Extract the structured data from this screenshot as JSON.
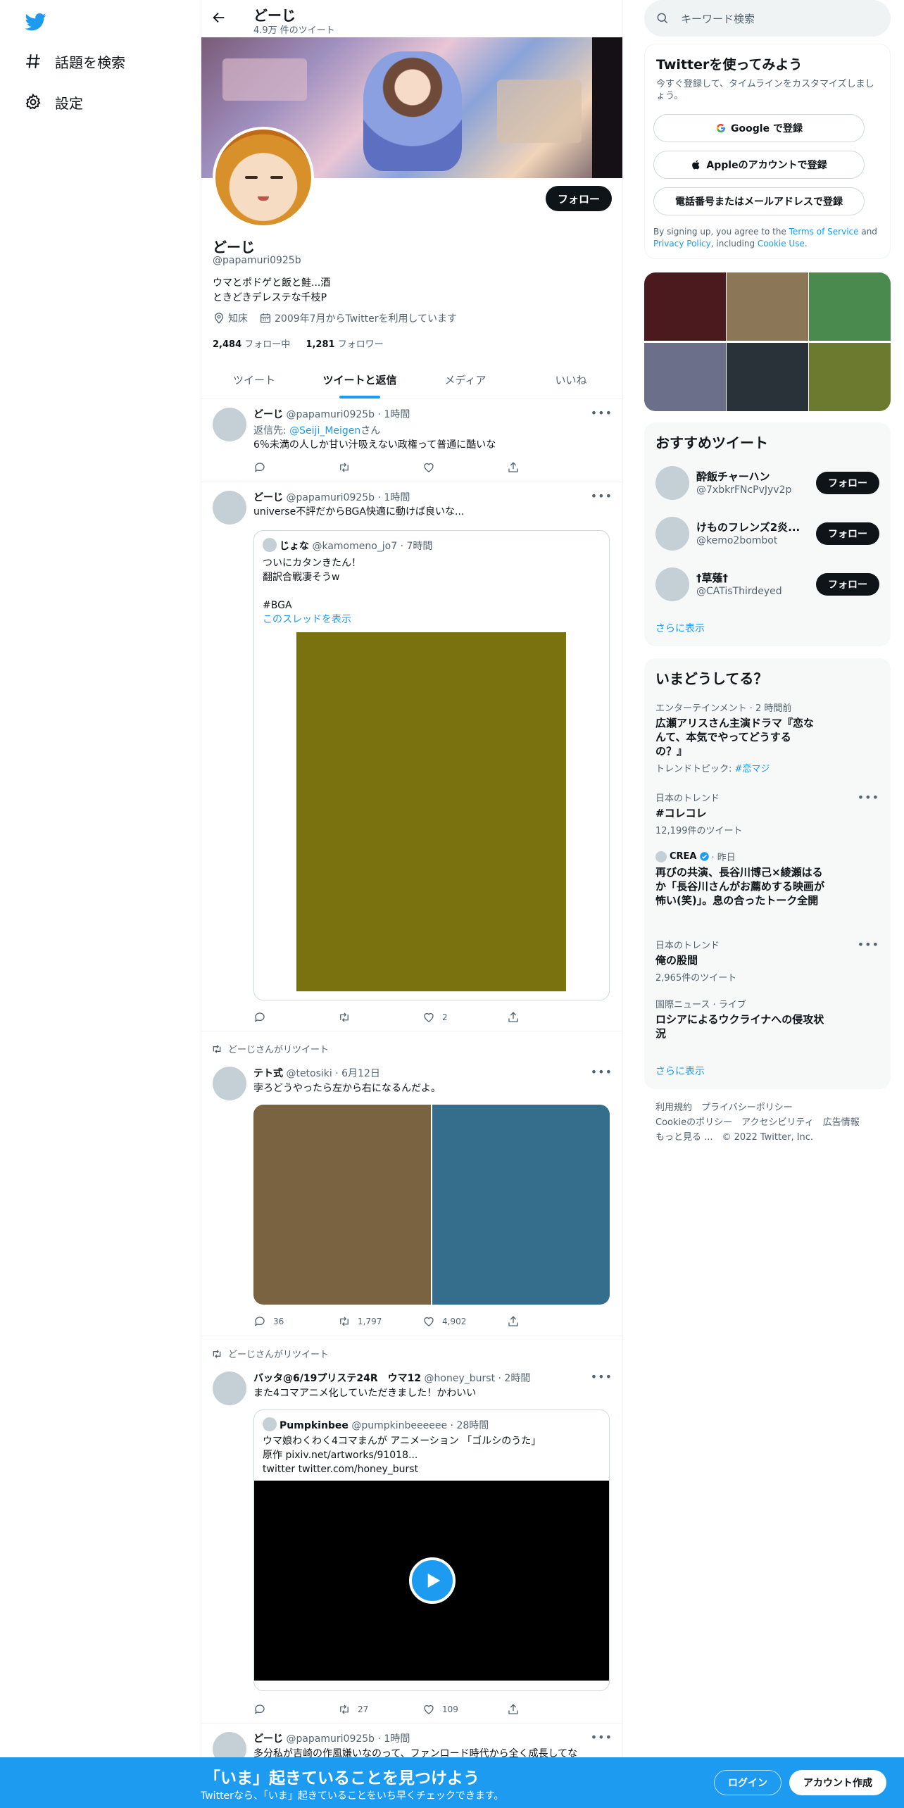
{
  "nav": {
    "explore_label": "話題を検索",
    "settings_label": "設定"
  },
  "profile": {
    "header_name": "どーじ",
    "tweet_count": "4.9万 件のツイート",
    "follow_button": "フォロー",
    "name": "どーじ",
    "handle": "@papamuri0925b",
    "bio": "ウマとポドゲと飯と鮭...酒\nときどきデレステな千枝P",
    "location": "知床",
    "joined": "2009年7月からTwitterを利用しています",
    "following_count": "2,484",
    "following_label": "フォロー中",
    "followers_count": "1,281",
    "followers_label": "フォロワー"
  },
  "tabs": [
    {
      "label": "ツイート"
    },
    {
      "label": "ツイートと返信"
    },
    {
      "label": "メディア"
    },
    {
      "label": "いいね"
    }
  ],
  "tweets": [
    {
      "name": "どーじ",
      "meta": "@papamuri0925b · 1時間",
      "reply_prefix": "返信先: ",
      "reply_to": "@Seiji_Meigen",
      "reply_suffix": "さん",
      "text": "6％未満の人しか甘い汁吸えない政権って普通に酷いな"
    },
    {
      "name": "どーじ",
      "meta": "@papamuri0925b · 1時間",
      "text": "universe不評だからBGA快適に動けば良いな...",
      "quote": {
        "name": "じょな",
        "meta": "@kamomeno_jo7 · 7時間",
        "text": "ついにカタンきたん！\n翻訳合戦凄そうw\n\n#BGA",
        "thread_link": "このスレッドを表示",
        "media_color": "#7a710f"
      },
      "likes": "2"
    },
    {
      "retweet_label": "どーじさんがリツイート",
      "name": "テト式",
      "meta": "@tetosiki · 6月12日",
      "text": "孛ろどうやったら左から右になるんだよ。",
      "media_colors": [
        "#7a6340",
        "#356e8c"
      ],
      "replies": "36",
      "retweets": "1,797",
      "likes": "4,902"
    },
    {
      "retweet_label": "どーじさんがリツイート",
      "name": "バッタ@6/19プリステ24R　ウマ12",
      "meta": "@honey_burst · 2時間",
      "text": "また4コマアニメ化していただきました！かわいい",
      "quote": {
        "name": "Pumpkinbee",
        "meta": "@pumpkinbeeeeee · 28時間",
        "text": "ウマ娘わくわく4コマまんが アニメーション 「ゴルシのうた」\n原作 pixiv.net/artworks/91018...\ntwitter twitter.com/honey_burst"
      },
      "retweets": "27",
      "likes": "109"
    },
    {
      "name": "どーじ",
      "meta": "@papamuri0925b · 1時間",
      "text": "多分私が吉崎の作風嫌いなのって、ファンロード時代から全く成長してな"
    }
  ],
  "sidebar": {
    "search_placeholder": "キーワード検索",
    "signup": {
      "title": "Twitterを使ってみよう",
      "subtitle": "今すぐ登録して、タイムラインをカスタマイズしましょう。",
      "google_button": "Google で登録",
      "apple_button": "Appleのアカウントで登録",
      "phone_button": "電話番号またはメールアドレスで登録",
      "terms_prefix": "By signing up, you agree to the ",
      "terms_link": "Terms of Service",
      "terms_and": " and ",
      "privacy_link": "Privacy Policy",
      "terms_including": ", including ",
      "cookie_link": "Cookie Use",
      "terms_end": "."
    },
    "media_tiles": [
      "#4a1a1e",
      "#8b7657",
      "#4a8a4e",
      "#6c6f8a",
      "#283238",
      "#6b7a2e"
    ],
    "recommended": {
      "title": "おすすめツイート",
      "users": [
        {
          "name": "酔飯チャーハン",
          "handle": "@7xbkrFNcPvJyv2p",
          "button": "フォロー"
        },
        {
          "name": "けものフレンズ2炎...",
          "handle": "@kemo2bombot",
          "button": "フォロー"
        },
        {
          "name": "†草薙†",
          "handle": "@CATisThirdeyed",
          "button": "フォロー"
        }
      ],
      "show_more": "さらに表示"
    },
    "trends": {
      "title": "いまどうしてる？",
      "items": [
        {
          "category": "エンターテインメント · 2 時間前",
          "title": "広瀬アリスさん主演ドラマ『恋なんて、本気でやってどうするの？』",
          "extra_prefix": "トレンドトピック: ",
          "extra_link": "#恋マジ"
        },
        {
          "category": "日本のトレンド",
          "title": "#コレコレ",
          "count": "12,199件のツイート"
        },
        {
          "source": "CREA",
          "time": "· 昨日",
          "title": "再びの共演、長谷川博己×綾瀬はるか「長谷川さんがお薦めする映画が 怖い(笑)」。息の合ったトーク全開"
        },
        {
          "category": "日本のトレンド",
          "title": "俺の股間",
          "count": "2,965件のツイート"
        },
        {
          "category": "国際ニュース · ライブ",
          "title": "ロシアによるウクライナへの侵攻状況"
        }
      ],
      "show_more": "さらに表示"
    },
    "footer": {
      "line1": "利用規約　プライバシーポリシー",
      "line2": "Cookieのポリシー　アクセシビリティ　広告情報",
      "line3": "もっと見る ...　© 2022 Twitter, Inc."
    }
  },
  "bottom_bar": {
    "title": "「いま」起きていることを見つけよう",
    "subtitle": "Twitterなら、「いま」起きていることをいち早くチェックできます。",
    "login_button": "ログイン",
    "signup_button": "アカウント作成"
  },
  "colors": {
    "accent": "#1d9bf0",
    "text": "#0f1419",
    "muted": "#536471"
  }
}
